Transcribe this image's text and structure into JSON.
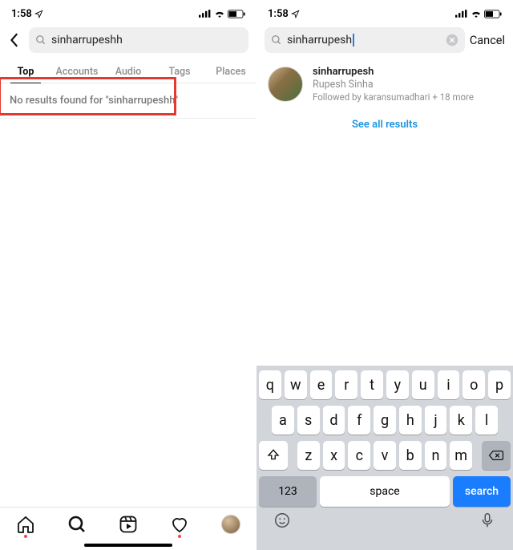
{
  "status": {
    "time": "1:58",
    "signal": "signal",
    "wifi": "wifi",
    "battery": "battery"
  },
  "left": {
    "search_query": "sinharrupeshh",
    "tabs": [
      "Top",
      "Accounts",
      "Audio",
      "Tags",
      "Places"
    ],
    "active_tab_index": 0,
    "no_results_text": "No results found for \"sinharrupeshh\""
  },
  "right": {
    "search_query": "sinharrupesh",
    "cancel_label": "Cancel",
    "result": {
      "username": "sinharrupesh",
      "fullname": "Rupesh Sinha",
      "followed_by": "Followed by karansumadhari + 18 more"
    },
    "see_all_label": "See all results",
    "keyboard": {
      "row1": [
        "q",
        "w",
        "e",
        "r",
        "t",
        "y",
        "u",
        "i",
        "o",
        "p"
      ],
      "row2": [
        "a",
        "s",
        "d",
        "f",
        "g",
        "h",
        "j",
        "k",
        "l"
      ],
      "row3": [
        "z",
        "x",
        "c",
        "v",
        "b",
        "n",
        "m"
      ],
      "num_label": "123",
      "space_label": "space",
      "search_label": "search"
    }
  }
}
